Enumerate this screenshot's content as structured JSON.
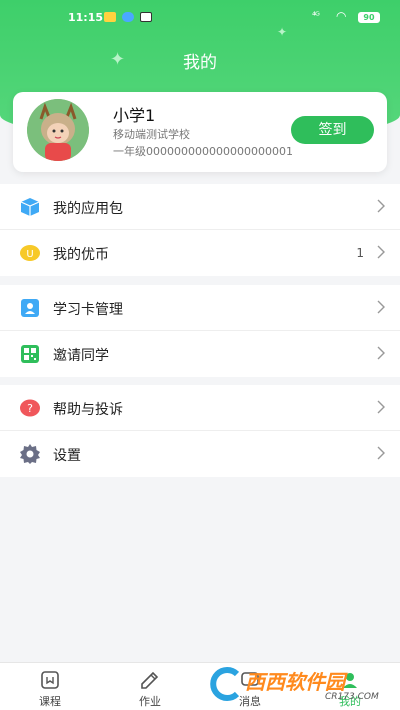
{
  "status_bar": {
    "time": "11:15",
    "signal": "⁴ᴳ",
    "battery": "90"
  },
  "header": {
    "title": "我的"
  },
  "profile": {
    "name": "小学1",
    "school": "移动端测试学校",
    "class_info": "一年级000000000000000000001",
    "signin_label": "签到"
  },
  "menu": {
    "group1": [
      {
        "label": "我的应用包",
        "value": ""
      },
      {
        "label": "我的优币",
        "value": "1"
      }
    ],
    "group2": [
      {
        "label": "学习卡管理"
      },
      {
        "label": "邀请同学"
      }
    ],
    "group3": [
      {
        "label": "帮助与投诉"
      },
      {
        "label": "设置"
      }
    ]
  },
  "tabbar": {
    "tabs": [
      {
        "label": "课程"
      },
      {
        "label": "作业"
      },
      {
        "label": "消息"
      },
      {
        "label": "我的"
      }
    ]
  },
  "watermark": {
    "text": "西西软件园",
    "sub": "CR173.COM"
  },
  "colors": {
    "primary": "#2fbe5b",
    "header": "#3ecf6a",
    "background": "#f4f5f7"
  }
}
